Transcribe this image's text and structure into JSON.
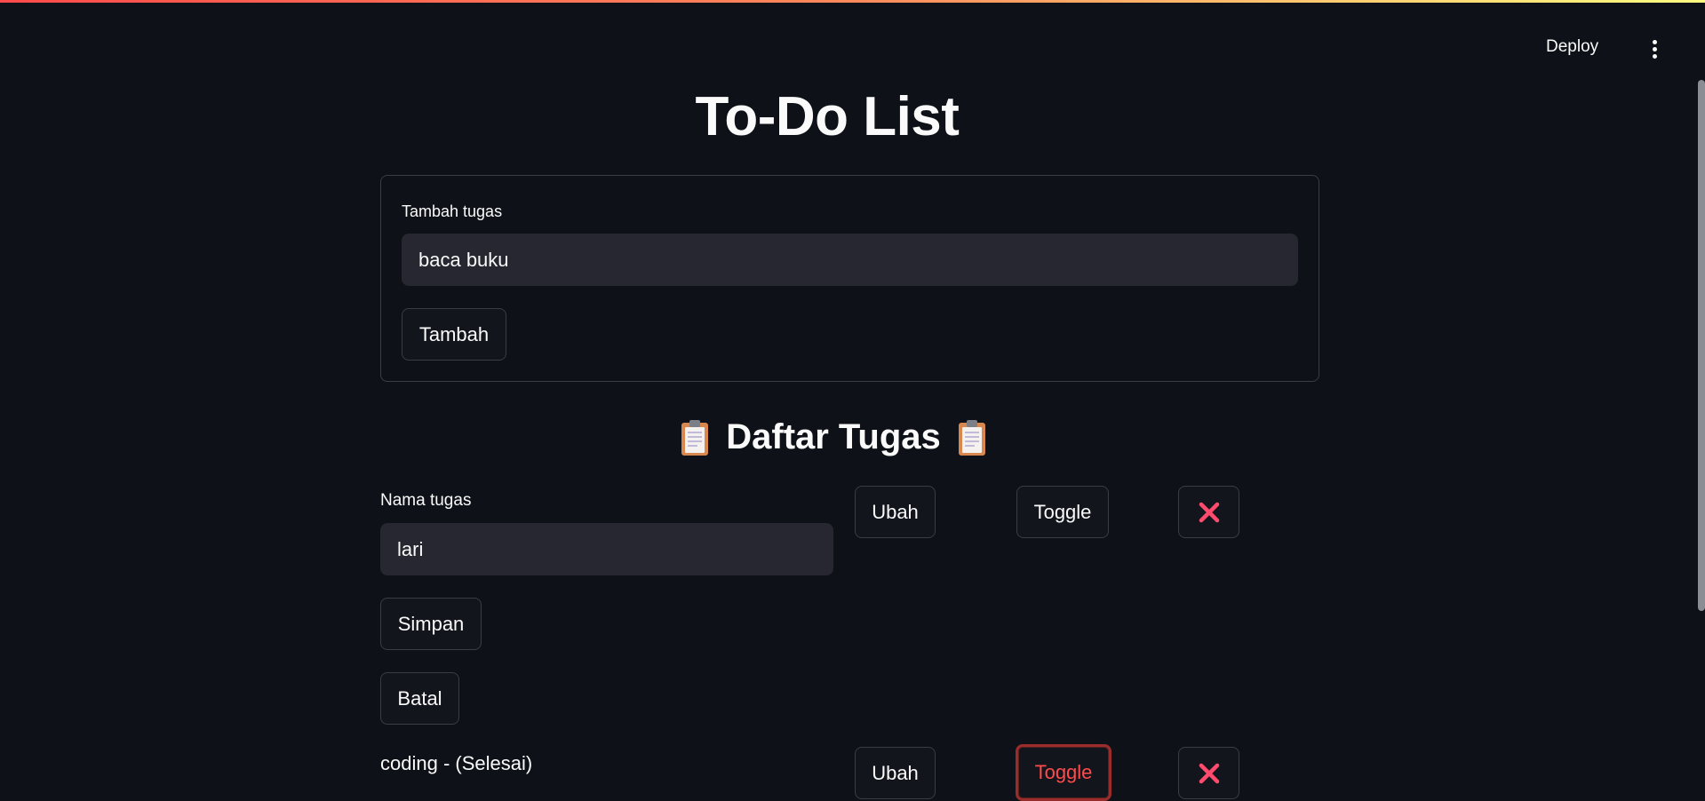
{
  "header": {
    "deploy_label": "Deploy",
    "menu_icon": "kebab-menu-icon"
  },
  "page": {
    "title": "To-Do List"
  },
  "add_form": {
    "label": "Tambah tugas",
    "input_value": "baca buku",
    "submit_label": "Tambah"
  },
  "task_list": {
    "heading": "Daftar Tugas",
    "heading_icon": "clipboard-icon",
    "tasks": [
      {
        "edit_label": "Nama tugas",
        "edit_value": "lari",
        "save_label": "Simpan",
        "cancel_label": "Batal",
        "edit_button_label": "Ubah",
        "toggle_button_label": "Toggle",
        "delete_icon": "close-icon"
      },
      {
        "label": "coding - (Selesai)",
        "edit_button_label": "Ubah",
        "toggle_button_label": "Toggle",
        "delete_icon": "close-icon"
      }
    ]
  },
  "colors": {
    "background": "#0e1117",
    "input_bg": "#262730",
    "accent": "#ff4b4b",
    "delete_icon": "#ff4b6e"
  }
}
